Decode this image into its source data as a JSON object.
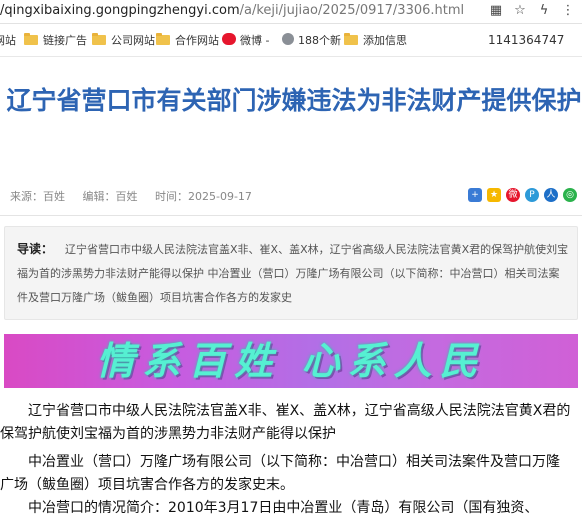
{
  "address_bar": {
    "url_main": "/qingxibaixing.gongpingzhengyi.com",
    "url_path": "/a/keji/jujiao/2025/0917/3306.html"
  },
  "bookmarks": [
    {
      "label": "网站",
      "icon": "folder-icon"
    },
    {
      "label": "链接广告",
      "icon": "folder-icon"
    },
    {
      "label": "公司网站",
      "icon": "folder-icon"
    },
    {
      "label": "合作网站",
      "icon": "folder-icon"
    },
    {
      "label": "微博 -",
      "icon": "weibo-icon"
    },
    {
      "label": "188个新",
      "icon": "globe-icon"
    },
    {
      "label": "添加信思",
      "icon": "folder-icon"
    }
  ],
  "bookmark_number": "1141364747",
  "article": {
    "title": "辽宁省营口市有关部门涉嫌违法为非法财产提供保护",
    "source": "来源：百姓",
    "editor": "编辑：百姓",
    "time": "时间：2025-09-17",
    "guide_label": "导读：",
    "guide_text": "辽宁省营口市中级人民法院法官盖X非、崔X、盖X林，辽宁省高级人民法院法官黄X君的保驾护航使刘宝福为首的涉黑势力非法财产能得以保护 中冶置业（营口）万隆广场有限公司（以下简称：中冶营口）相关司法案件及营口万隆广场（鲅鱼圈）项目坑害合作各方的发家史",
    "banner_text": "情系百姓 心系人民",
    "paragraphs": [
      "辽宁省营口市中级人民法院法官盖X非、崔X、盖X林，辽宁省高级人民法院法官黄X君的保驾护航使刘宝福为首的涉黑势力非法财产能得以保护",
      "中冶置业（营口）万隆广场有限公司（以下简称：中冶营口）相关司法案件及营口万隆广场（鲅鱼圈）项目坑害合作各方的发家史末。",
      "中冶营口的情况简介：2010年3月17日由中冶置业（青岛）有限公司（国有独资、"
    ]
  },
  "colors": {
    "title": "#2d64b3",
    "banner_text": "#56f0d2",
    "banner_bg": "#c75ce0"
  }
}
